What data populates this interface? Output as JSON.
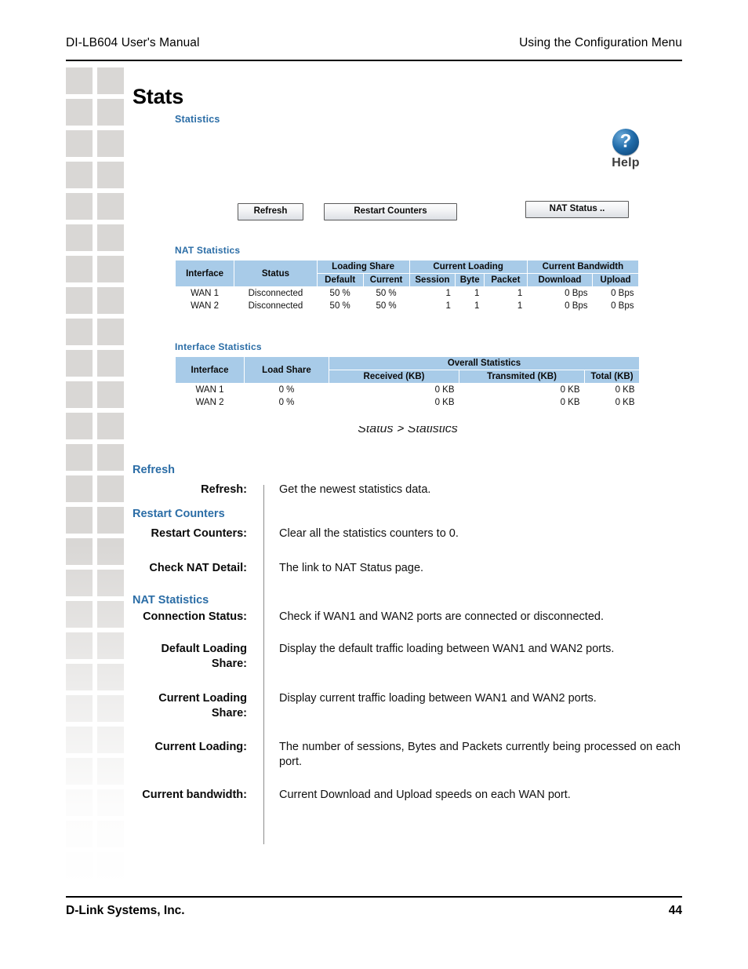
{
  "header": {
    "left": "DI-LB604 User's Manual",
    "right": "Using the Configuration Menu"
  },
  "page_title": "Stats",
  "screenshot": {
    "title": "Statistics",
    "help": {
      "icon": "question-mark-circle-icon",
      "label": "Help"
    },
    "buttons": {
      "refresh": "Refresh",
      "restart_counters": "Restart Counters",
      "nat_status": "NAT Status .."
    },
    "nat_statistics": {
      "caption": "NAT Statistics",
      "group_headers": [
        "Interface",
        "Status",
        "Loading Share",
        "Current Loading",
        "Current Bandwidth"
      ],
      "sub_headers": [
        "Default",
        "Current",
        "Session",
        "Byte",
        "Packet",
        "Download",
        "Upload"
      ],
      "rows": [
        {
          "interface": "WAN 1",
          "status": "Disconnected",
          "default_share": "50 %",
          "current_share": "50 %",
          "session": "1",
          "byte": "1",
          "packet": "1",
          "download": "0 Bps",
          "upload": "0 Bps"
        },
        {
          "interface": "WAN 2",
          "status": "Disconnected",
          "default_share": "50 %",
          "current_share": "50 %",
          "session": "1",
          "byte": "1",
          "packet": "1",
          "download": "0 Bps",
          "upload": "0 Bps"
        }
      ]
    },
    "interface_statistics": {
      "caption": "Interface Statistics",
      "group_headers": [
        "Interface",
        "Load Share",
        "Overall Statistics"
      ],
      "sub_headers": [
        "Received (KB)",
        "Transmited (KB)",
        "Total (KB)"
      ],
      "rows": [
        {
          "interface": "WAN 1",
          "load_share": "0 %",
          "received": "0 KB",
          "transmited": "0 KB",
          "total": "0 KB"
        },
        {
          "interface": "WAN 2",
          "load_share": "0 %",
          "received": "0 KB",
          "transmited": "0 KB",
          "total": "0 KB"
        }
      ]
    },
    "caption": "Status > Statistics"
  },
  "definitions": {
    "section_refresh": "Refresh",
    "section_restart": "Restart Counters",
    "section_nat": "NAT Statistics",
    "items": [
      {
        "term": "Refresh:",
        "desc": "Get the newest statistics data."
      },
      {
        "term": "Restart Counters:",
        "desc": "Clear all the statistics counters to 0."
      },
      {
        "term": "Check NAT Detail:",
        "desc": "The link to NAT Status page."
      },
      {
        "term": "Connection Status:",
        "desc": "Check if WAN1 and WAN2 ports are connected or disconnected."
      },
      {
        "term": "Default Loading Share:",
        "desc": "Display the default traffic loading between WAN1 and WAN2 ports."
      },
      {
        "term": "Current Loading Share:",
        "desc": "Display current traffic loading between WAN1 and WAN2 ports."
      },
      {
        "term": "Current Loading:",
        "desc": "The number of sessions, Bytes and Packets currently being processed on each port."
      },
      {
        "term": "Current bandwidth:",
        "desc": "Current Download and Upload speeds on each WAN port."
      }
    ]
  },
  "footer": {
    "company": "D-Link Systems, Inc.",
    "page_number": "44"
  },
  "colors": {
    "accent_blue": "#2b6da6",
    "table_header": "#a8cbe8",
    "margin_square": "#d9d7d5"
  }
}
